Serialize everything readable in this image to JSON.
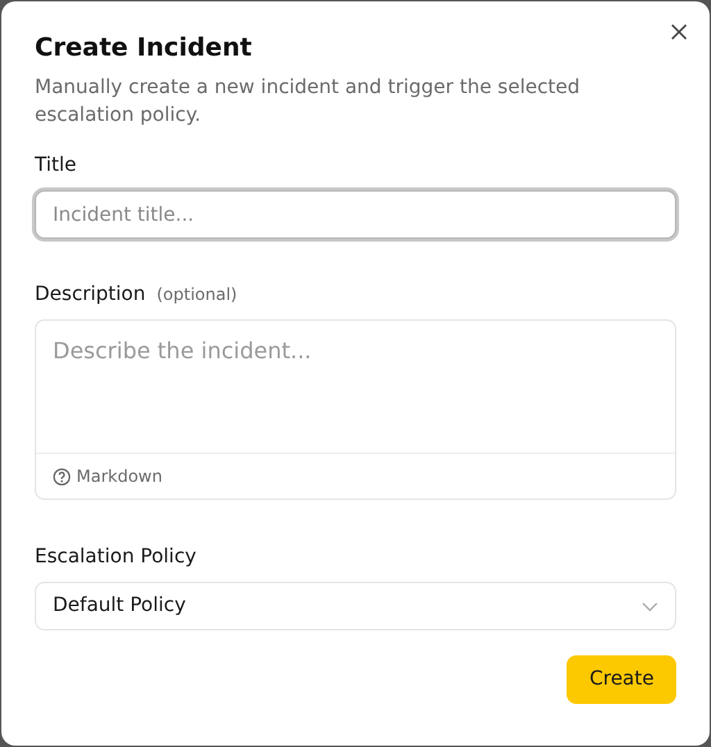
{
  "dialog": {
    "title": "Create Incident",
    "subtitle": "Manually create a new incident and trigger the selected escalation policy."
  },
  "fields": [
    {
      "kind": "text",
      "label": "Title",
      "placeholder": "Incident title...",
      "focused": true
    },
    {
      "kind": "textarea",
      "label": "Description",
      "hint": "(optional)",
      "placeholder": "Describe the incident...",
      "footer": "Markdown",
      "focused": false
    },
    {
      "kind": "select",
      "label": "Escalation Policy",
      "value": "Default Policy",
      "focused": false
    }
  ],
  "buttons": [
    "Create"
  ]
}
